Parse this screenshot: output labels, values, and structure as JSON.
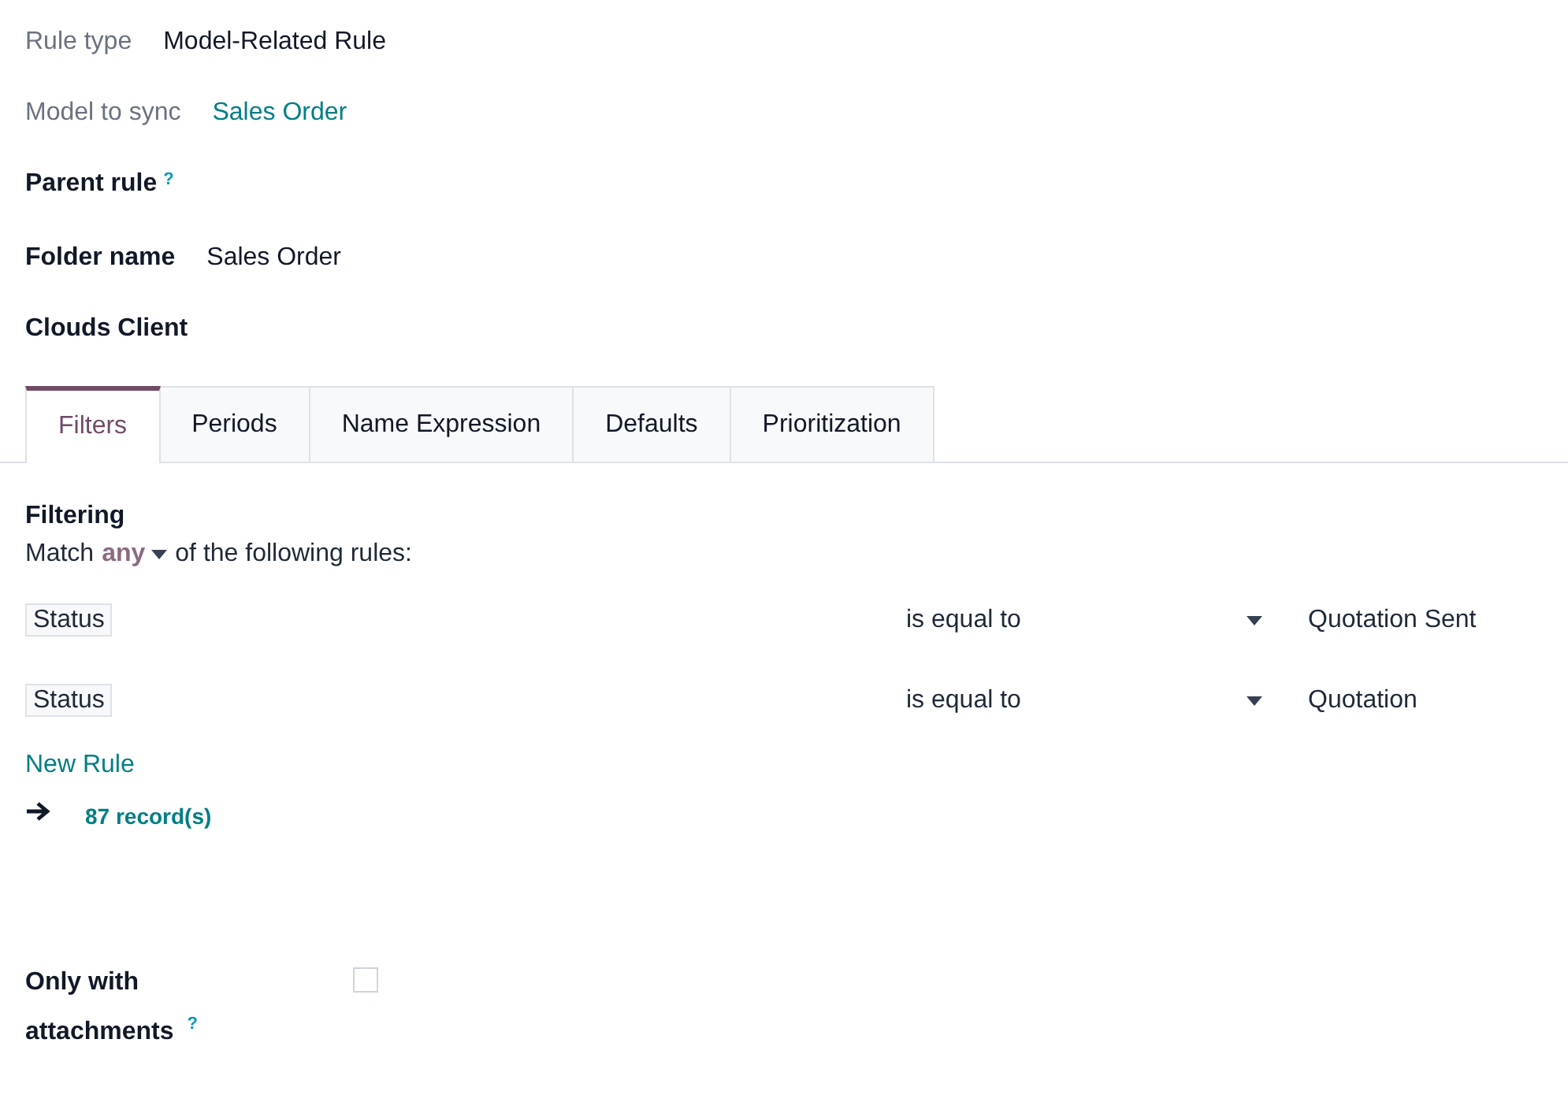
{
  "fields": [
    {
      "kind": "plain",
      "label": "Rule type",
      "value": "Model-Related Rule"
    },
    {
      "kind": "link",
      "label": "Model to sync",
      "value": "Sales Order"
    },
    {
      "kind": "heading",
      "label": "Parent rule",
      "help": "?"
    },
    {
      "kind": "heading",
      "label": "Folder name",
      "value": "Sales Order"
    },
    {
      "kind": "heading",
      "label": "Clouds Client"
    }
  ],
  "tabs": [
    {
      "label": "Filters",
      "selected": true
    },
    {
      "label": "Periods",
      "selected": false
    },
    {
      "label": "Name Expression",
      "selected": false
    },
    {
      "label": "Defaults",
      "selected": false
    },
    {
      "label": "Prioritization",
      "selected": false
    }
  ],
  "filtering": {
    "title": "Filtering",
    "match_prefix": "Match",
    "match_value": "any",
    "match_suffix": "of the following rules:",
    "rules": [
      {
        "field": "Status",
        "operator": "is equal to",
        "value": "Quotation Sent"
      },
      {
        "field": "Status",
        "operator": "is equal to",
        "value": "Quotation"
      }
    ],
    "new_rule": "New Rule",
    "records": "87 record(s)"
  },
  "attachments": {
    "label": "Only with attachments",
    "help": "?",
    "checked": false
  }
}
